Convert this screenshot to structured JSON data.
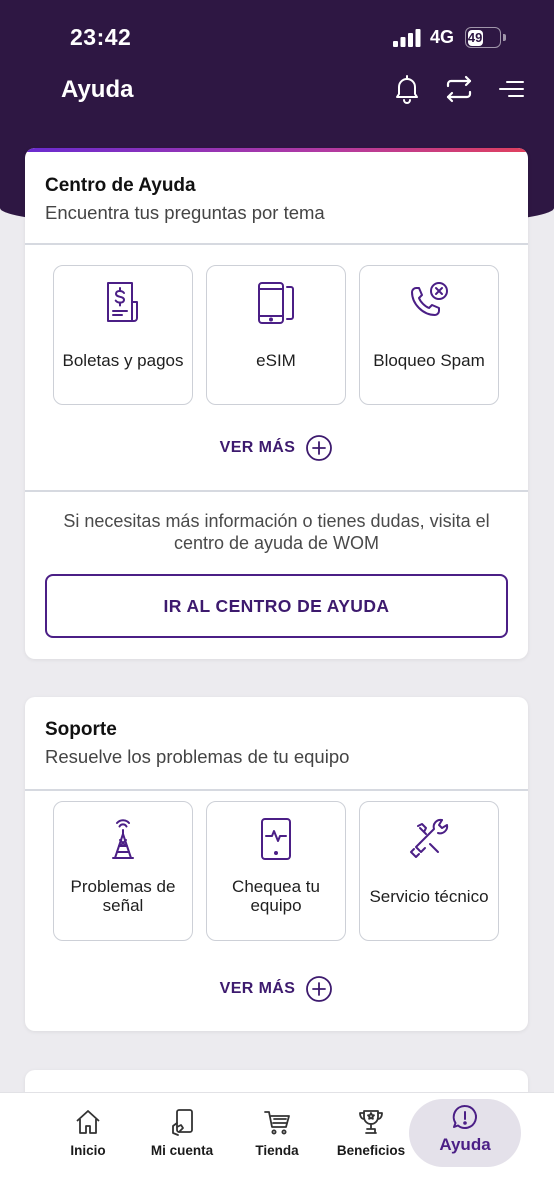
{
  "status_bar": {
    "time": "23:42",
    "network": "4G",
    "battery": "49"
  },
  "header": {
    "title": "Ayuda",
    "icons": [
      "bell-icon",
      "swap-icon",
      "menu-icon"
    ]
  },
  "help_center": {
    "title": "Centro de Ayuda",
    "subtitle": "Encuentra tus preguntas por tema",
    "tiles": [
      {
        "label": "Boletas y pagos",
        "icon": "bill-dollar-icon"
      },
      {
        "label": "eSIM",
        "icon": "phone-esim-icon"
      },
      {
        "label": "Bloqueo Spam",
        "icon": "phone-block-icon"
      }
    ],
    "see_more": "VER MÁS",
    "info": "Si necesitas más información o tienes dudas, visita el centro de ayuda de WOM",
    "cta": "IR AL CENTRO DE AYUDA"
  },
  "support": {
    "title": "Soporte",
    "subtitle": "Resuelve los problemas de tu equipo",
    "tiles": [
      {
        "label": "Problemas de señal",
        "icon": "antenna-icon"
      },
      {
        "label": "Chequea tu equipo",
        "icon": "phone-pulse-icon"
      },
      {
        "label": "Servicio técnico",
        "icon": "repair-tools-icon"
      }
    ],
    "see_more": "VER MÁS"
  },
  "bottom_nav": {
    "items": [
      {
        "label": "Inicio",
        "icon": "home-icon"
      },
      {
        "label": "Mi cuenta",
        "icon": "account-icon"
      },
      {
        "label": "Tienda",
        "icon": "cart-icon"
      },
      {
        "label": "Beneficios",
        "icon": "trophy-icon"
      },
      {
        "label": "Ayuda",
        "icon": "help-icon",
        "active": true
      }
    ]
  },
  "colors": {
    "header_bg": "#2e1743",
    "accent": "#4b1f86",
    "page_bg": "#ecebef"
  }
}
